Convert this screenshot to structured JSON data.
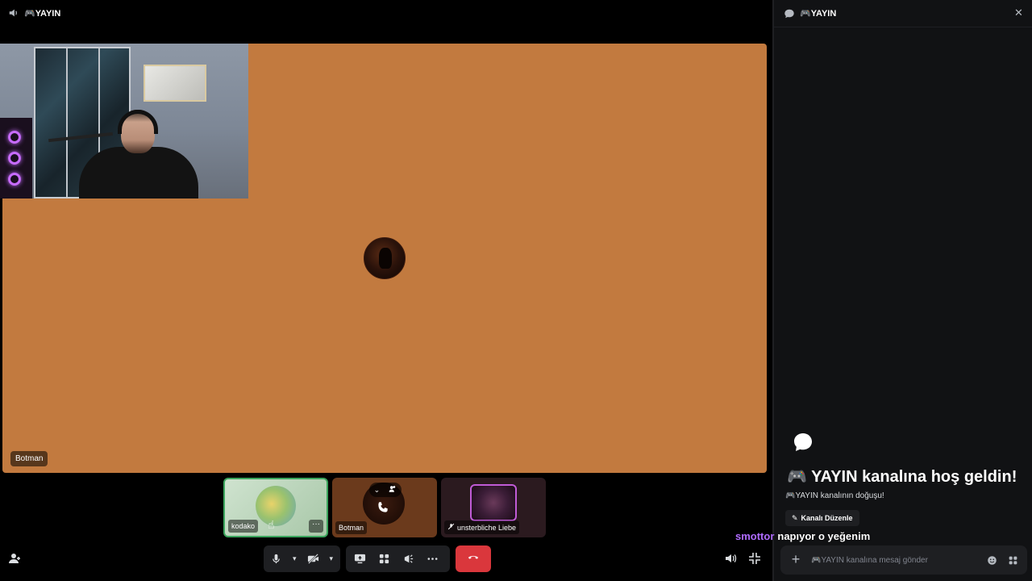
{
  "call": {
    "channel_title": "🎮YAYIN",
    "stage_name": "Botman"
  },
  "tiles": [
    {
      "name": "kodako"
    },
    {
      "name": "Botman"
    },
    {
      "name": "unsterbliche Liebe"
    }
  ],
  "chat": {
    "header_title": "🎮YAYIN",
    "welcome_title": "🎮 YAYIN kanalına hoş geldin!",
    "welcome_sub": "🎮YAYIN kanalının doğuşu!",
    "edit_channel_label": "Kanalı Düzenle",
    "composer_placeholder": "🎮YAYIN kanalına mesaj gönder"
  },
  "overlay_message": {
    "user": "smottor",
    "text": "napıyor o yeğenim"
  },
  "colors": {
    "stage_bg": "#c27a3f",
    "hangup": "#da373c",
    "speaking_border": "#3ba55d",
    "chat_bg": "#111214",
    "overlay_user": "#b06cff"
  },
  "icons": [
    "speaker-icon",
    "chat-bubble-icon",
    "close-icon",
    "microphone-icon",
    "camera-off-icon",
    "screen-share-icon",
    "activities-icon",
    "soundboard-icon",
    "more-icon",
    "hangup-icon",
    "invite-icon",
    "volume-icon",
    "exit-fullscreen-icon",
    "plus-icon",
    "emoji-icon",
    "apps-icon",
    "pencil-icon"
  ]
}
